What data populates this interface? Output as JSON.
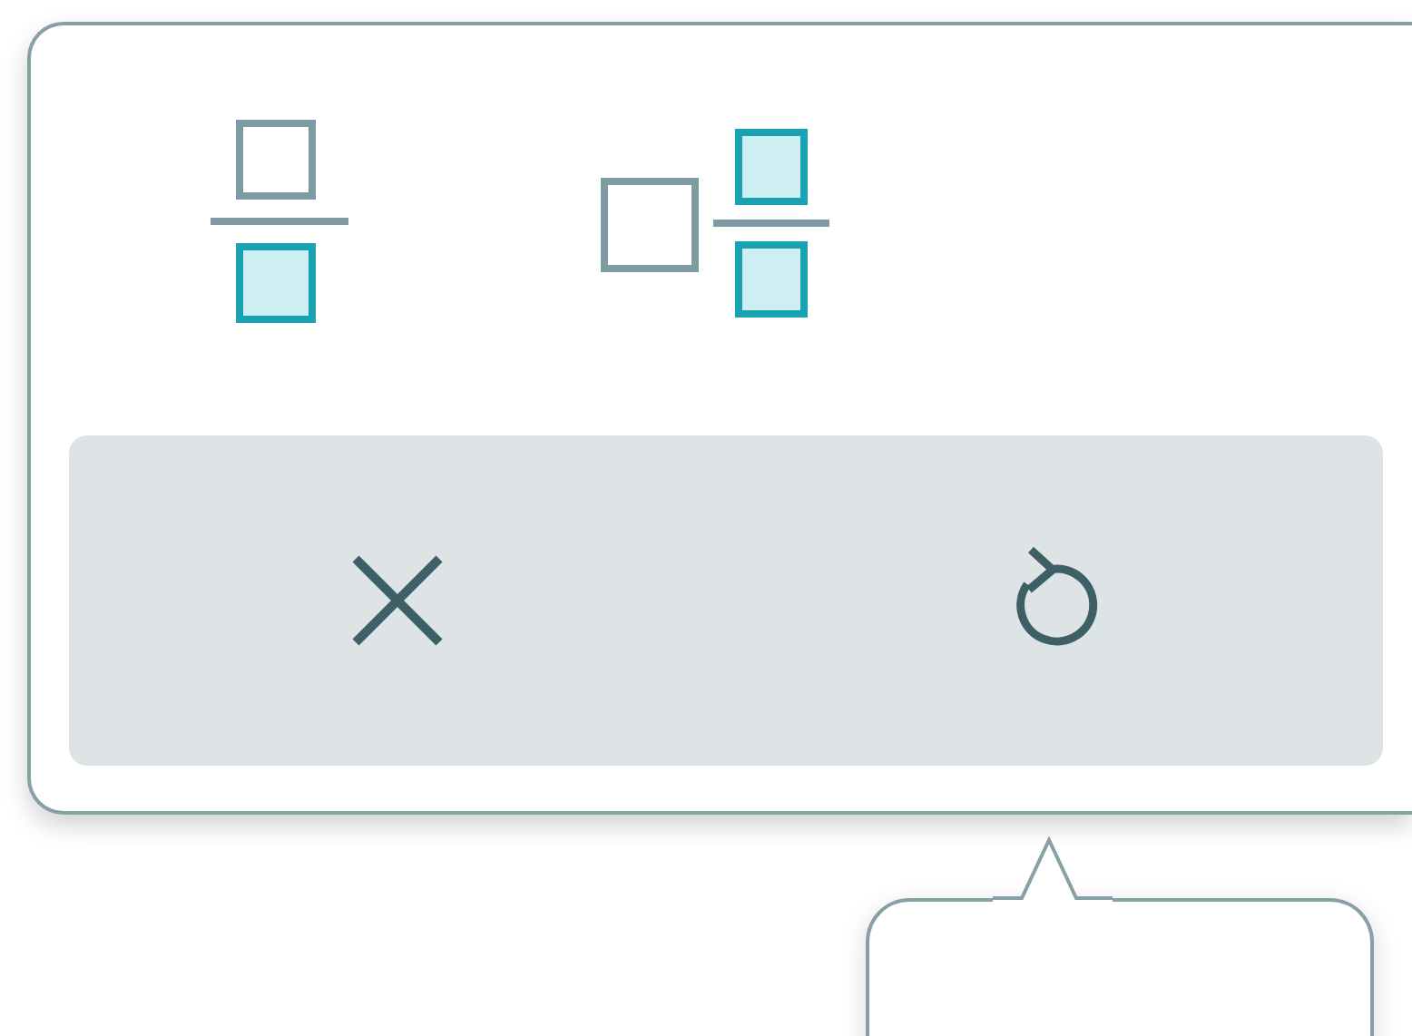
{
  "keypad": {
    "templates": [
      {
        "kind": "fraction"
      },
      {
        "kind": "mixed_number"
      }
    ],
    "actions": [
      {
        "kind": "clear"
      },
      {
        "kind": "undo"
      }
    ]
  }
}
